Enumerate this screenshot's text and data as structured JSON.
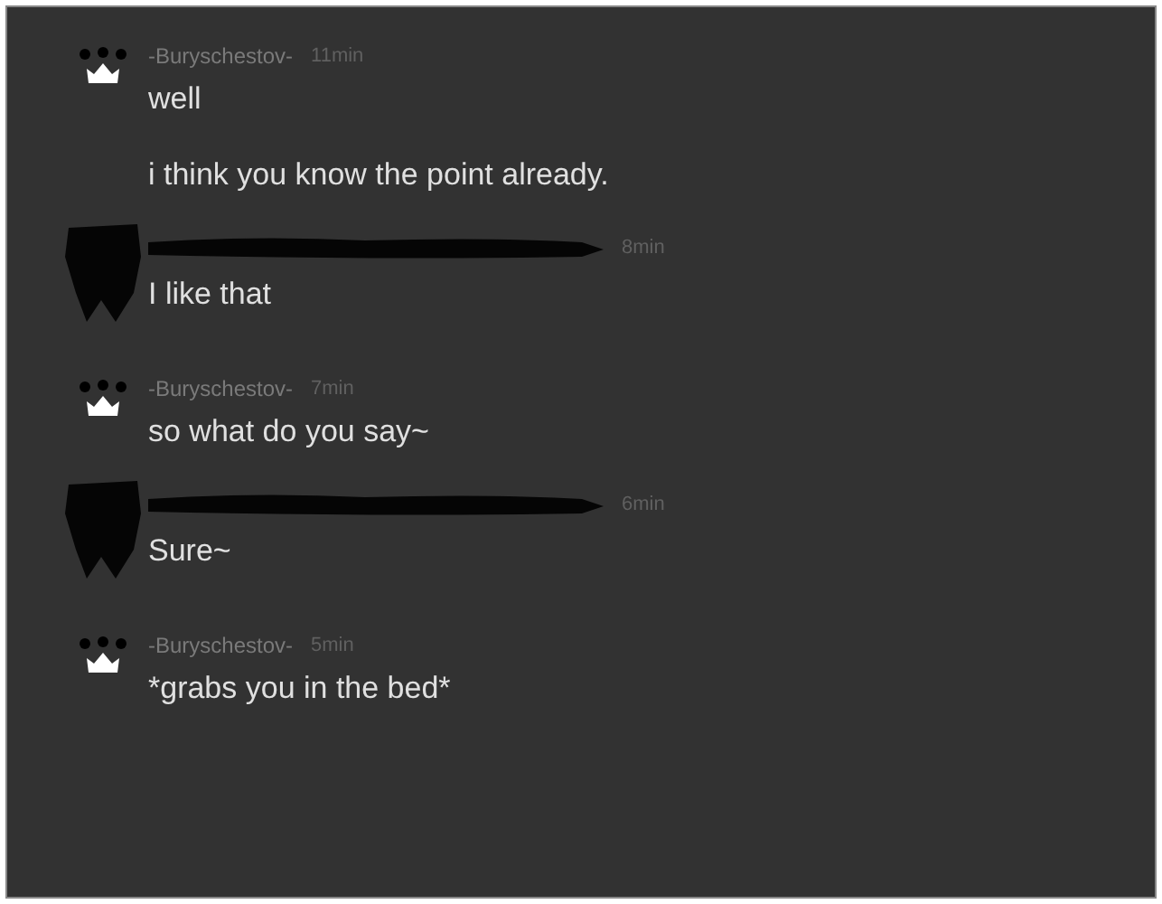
{
  "messages": [
    {
      "kind": "named",
      "author": "-Buryschestov-",
      "time": "11min",
      "lines": [
        "well",
        "i think you know the point already."
      ]
    },
    {
      "kind": "redacted",
      "time": "8min",
      "lines": [
        "I like that"
      ]
    },
    {
      "kind": "named",
      "author": "-Buryschestov-",
      "time": "7min",
      "lines": [
        "so what do you say~"
      ]
    },
    {
      "kind": "redacted",
      "time": "6min",
      "lines": [
        "Sure~"
      ]
    },
    {
      "kind": "named",
      "author": "-Buryschestov-",
      "time": "5min",
      "lines": [
        "*grabs you in the bed*"
      ]
    }
  ]
}
